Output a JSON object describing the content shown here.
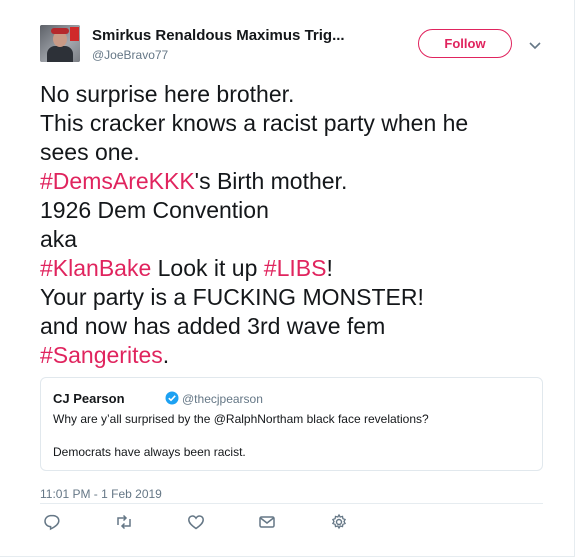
{
  "author": {
    "display_name": "Smirkus Renaldous Maximus Trig...",
    "handle": "@JoeBravo77",
    "avatar_icon": "user-avatar"
  },
  "follow_button": {
    "label": "Follow",
    "color": "#e0245e"
  },
  "menu_icon": "chevron-down-icon",
  "tweet": {
    "lines": [
      [
        {
          "text": "No surprise here brother."
        }
      ],
      [
        {
          "text": "This cracker knows a racist party when he"
        }
      ],
      [
        {
          "text": "sees one."
        }
      ],
      [
        {
          "text": "#DemsAreKKK",
          "hashtag": true
        },
        {
          "text": "'s Birth mother."
        }
      ],
      [
        {
          "text": "1926 Dem Convention"
        }
      ],
      [
        {
          "text": "aka"
        }
      ],
      [
        {
          "text": "#KlanBake",
          "hashtag": true
        },
        {
          "text": "  Look it up "
        },
        {
          "text": "#LIBS",
          "hashtag": true
        },
        {
          "text": "!"
        }
      ],
      [
        {
          "text": "Your party is a FUCKING MONSTER!"
        }
      ],
      [
        {
          "text": "and now has added 3rd wave fem"
        }
      ],
      [
        {
          "text": "#Sangerites",
          "hashtag": true
        },
        {
          "text": "."
        }
      ]
    ],
    "hashtag_color": "#e0245e"
  },
  "quoted_tweet": {
    "display_name": "CJ Pearson",
    "verified_icon": "verified-badge-icon",
    "handle": "@thecjpearson",
    "text_line1": "Why are y’all surprised by the @RalphNortham black face revelations?",
    "text_line2": "Democrats have always been racist."
  },
  "timestamp": "11:01 PM - 1 Feb 2019",
  "actions": [
    {
      "icon": "reply-icon"
    },
    {
      "icon": "retweet-icon"
    },
    {
      "icon": "like-icon"
    },
    {
      "icon": "direct-message-icon"
    },
    {
      "icon": "analytics-gear-icon"
    }
  ]
}
